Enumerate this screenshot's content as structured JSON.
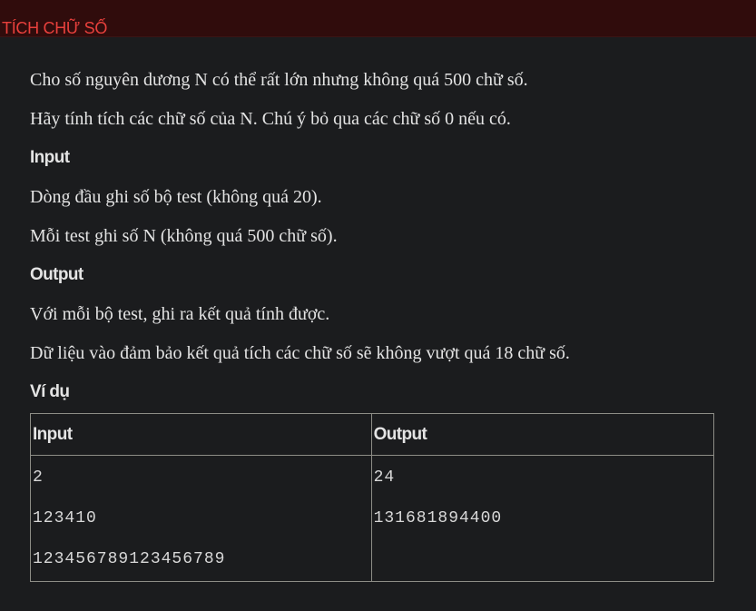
{
  "title": "TÍCH CHỮ SỐ",
  "statement": {
    "p1": "Cho số nguyên dương N có thể rất lớn nhưng không quá 500 chữ số.",
    "p2": "Hãy tính tích các chữ số của N. Chú ý bỏ qua các chữ số 0 nếu có."
  },
  "input_section": {
    "heading": "Input",
    "p1": "Dòng đầu ghi số bộ test (không quá 20).",
    "p2": "Mỗi test ghi số N (không quá 500 chữ số)."
  },
  "output_section": {
    "heading": "Output",
    "p1": "Với mỗi bộ test, ghi ra kết quả tính được.",
    "p2": "Dữ liệu vào đảm bảo kết quả tích các chữ số sẽ không vượt quá 18 chữ số."
  },
  "example": {
    "heading": "Ví dụ",
    "col_input": "Input",
    "col_output": "Output",
    "input_lines": [
      "2",
      "123410",
      "123456789123456789"
    ],
    "output_lines": [
      "24",
      "131681894400"
    ]
  }
}
